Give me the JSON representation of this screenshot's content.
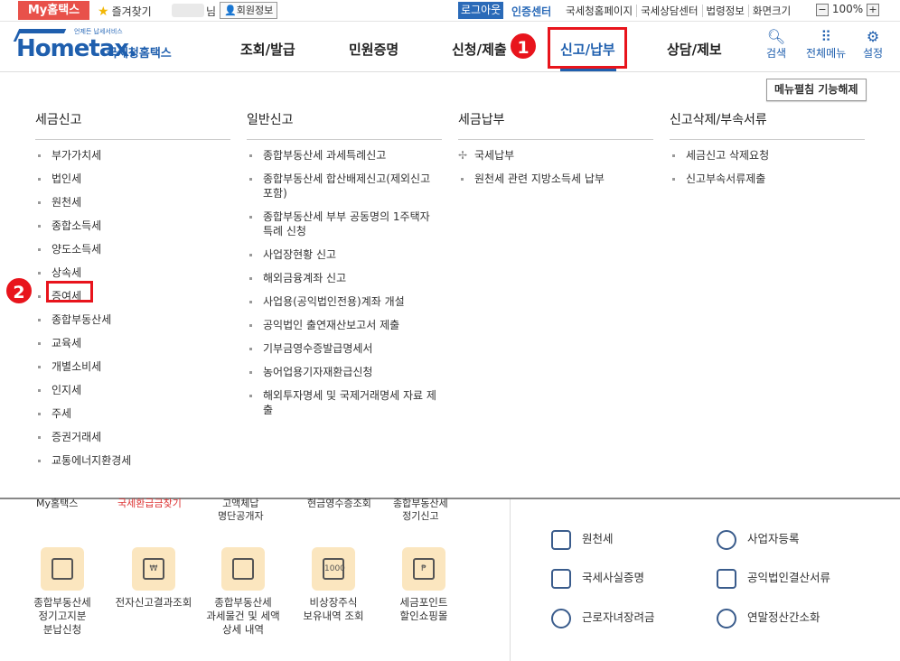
{
  "topbar": {
    "my_label": "My홈택스",
    "favorites_label": "즐겨찾기",
    "name_suffix": "님",
    "member_info": "회원정보",
    "logout": "로그아웃",
    "cert_center": "인증센터",
    "links": [
      "국세청홈페이지",
      "국세상담센터",
      "법령정보",
      "화면크기"
    ],
    "zoom_minus": "−",
    "zoom_value": "100%",
    "zoom_plus": "+"
  },
  "header": {
    "logo_small": "언제든 납세서비스",
    "logo_main": "Hometax.",
    "logo_kor": "국세청홈택스",
    "menu": [
      "조회/발급",
      "민원증명",
      "신청/제출",
      "신고/납부",
      "상담/제보"
    ],
    "active_menu": "신고/납부",
    "icons": [
      {
        "label": "검색",
        "icon": "search-icon"
      },
      {
        "label": "전체메뉴",
        "icon": "grid-icon"
      },
      {
        "label": "설정",
        "icon": "gear-icon"
      }
    ],
    "badge1": "1",
    "badge2": "2"
  },
  "panel": {
    "fold_button": "메뉴펼침 기능해제",
    "columns": [
      {
        "title": "세금신고",
        "items": [
          "부가가치세",
          "법인세",
          "원천세",
          "종합소득세",
          "양도소득세",
          "상속세",
          "증여세",
          "종합부동산세",
          "교육세",
          "개별소비세",
          "인지세",
          "주세",
          "증권거래세",
          "교통에너지환경세"
        ]
      },
      {
        "title": "일반신고",
        "items": [
          "종합부동산세 과세특례신고",
          "종합부동산세 합산배제신고(제외신고 포함)",
          "종합부동산세 부부 공동명의 1주택자 특례 신청",
          "사업장현황 신고",
          "해외금융계좌 신고",
          "사업용(공익법인전용)계좌 개설",
          "공익법인 출연재산보고서 제출",
          "기부금영수증발급명세서",
          "농어업용기자재환급신청",
          "해외투자명세 및 국제거래명세 자료 제출"
        ]
      },
      {
        "title": "세금납부",
        "items": [
          "국세납부",
          "원천세 관련 지방소득세 납부"
        ]
      },
      {
        "title": "신고삭제/부속서류",
        "items": [
          "세금신고 삭제요청",
          "신고부속서류제출"
        ]
      }
    ]
  },
  "lower": {
    "cut_texts": [
      "My홈택스",
      "국세환급금찾기",
      "고액체납\n명단공개자",
      "현금영수증조회",
      "종합부동산세\n정기신고"
    ],
    "quick_items": [
      {
        "label": "종합부동산세\n정기고지분\n분납신청",
        "icon": "calendar-icon"
      },
      {
        "label": "전자신고결과조회",
        "icon": "search-doc-icon"
      },
      {
        "label": "종합부동산세\n과세물건 및 세액\n상세 내역",
        "icon": "calendar-check-icon"
      },
      {
        "label": "비상장주식\n보유내역 조회",
        "icon": "money-icon"
      },
      {
        "label": "세금포인트\n할인쇼핑몰",
        "icon": "shopping-bag-icon"
      }
    ],
    "right_items": [
      {
        "label": "원천세",
        "icon": "salary-doc-icon"
      },
      {
        "label": "사업자등록",
        "icon": "person-icon"
      },
      {
        "label": "국세사실증명",
        "icon": "document-icon"
      },
      {
        "label": "공익법인결산서류",
        "icon": "clipboard-check-icon"
      },
      {
        "label": "근로자녀장려금",
        "icon": "heart-icon"
      },
      {
        "label": "연말정산간소화",
        "icon": "calculator-icon"
      }
    ]
  }
}
